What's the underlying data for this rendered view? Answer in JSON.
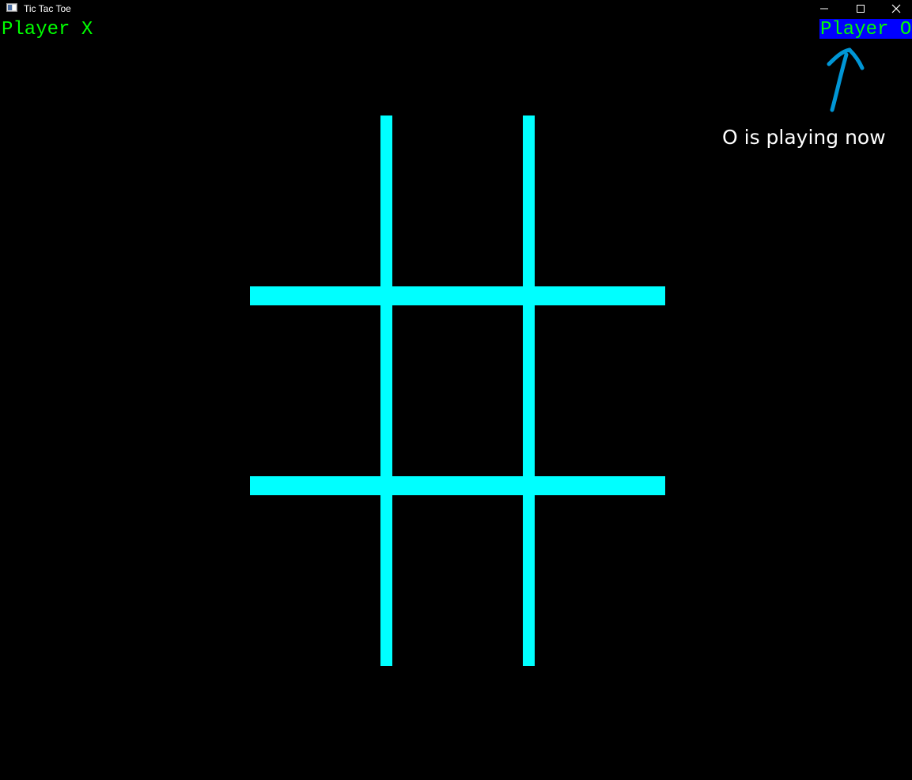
{
  "window": {
    "title": "Tic Tac Toe",
    "title_bar_controls": [
      "minimize-icon",
      "maximize-icon",
      "close-icon"
    ]
  },
  "players": {
    "x_label": "Player X",
    "o_label": "Player O",
    "active": "O"
  },
  "annotation": {
    "text": "O is playing now",
    "arrow_color": "#0096d6"
  },
  "board": {
    "cells": [
      "",
      "",
      "",
      "",
      "",
      "",
      "",
      "",
      ""
    ],
    "grid_color": "#00ffff"
  },
  "colors": {
    "background": "#000000",
    "player_text": "#00ff00",
    "active_highlight": "#0000ff",
    "annotation_text": "#ffffff"
  }
}
